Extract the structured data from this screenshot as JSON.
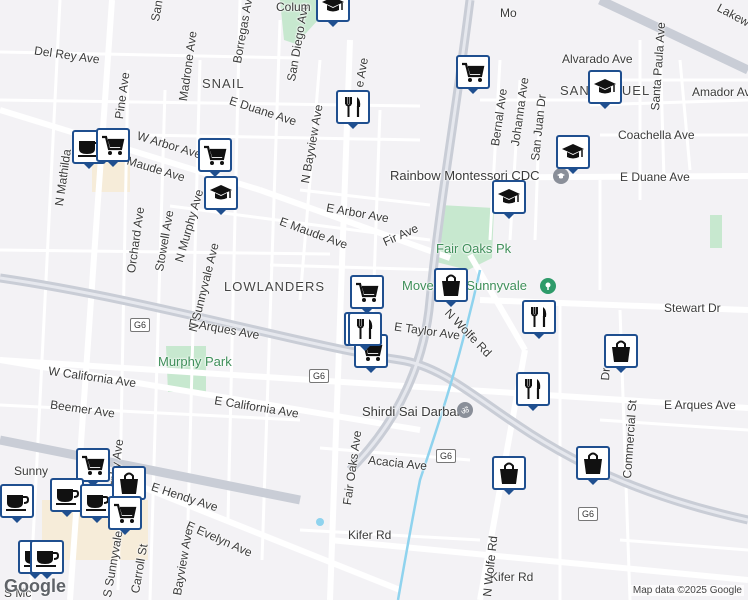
{
  "colors": {
    "road": "#ffffff",
    "highway": "#c9cdd6",
    "park": "#c7e8cf",
    "water": "#8fd3ee",
    "pin_border": "#1f4f8f",
    "poi_green": "#2e9b6a",
    "poi_gray": "#8a8f99"
  },
  "neighborhoods": [
    {
      "name": "SNAIL"
    },
    {
      "name": "LOWLANDERS"
    },
    {
      "name": "SAN MIGUEL"
    }
  ],
  "streets": [
    {
      "name": "Del Rey Ave"
    },
    {
      "name": "E Duane Ave"
    },
    {
      "name": "E Duane Ave"
    },
    {
      "name": "W Arbor Ave"
    },
    {
      "name": "Maude Ave"
    },
    {
      "name": "E Maude Ave"
    },
    {
      "name": "E Arbor Ave"
    },
    {
      "name": "Fir Ave"
    },
    {
      "name": "E Arques Ave"
    },
    {
      "name": "E Arques Ave"
    },
    {
      "name": "E Taylor Ave"
    },
    {
      "name": "W California Ave"
    },
    {
      "name": "E California Ave"
    },
    {
      "name": "Beemer Ave"
    },
    {
      "name": "Acacia Ave"
    },
    {
      "name": "E Hendy Ave"
    },
    {
      "name": "E Evelyn Ave"
    },
    {
      "name": "Kifer Rd"
    },
    {
      "name": "Kifer Rd"
    },
    {
      "name": "Stewart Dr"
    },
    {
      "name": "Alvarado Ave"
    },
    {
      "name": "Amador Ave"
    },
    {
      "name": "Coachella Ave"
    },
    {
      "name": "Lakew"
    },
    {
      "name": "N Mathilda"
    },
    {
      "name": "Pine Ave"
    },
    {
      "name": "Madrone Ave"
    },
    {
      "name": "Borregas Ave"
    },
    {
      "name": "San Diego Ave"
    },
    {
      "name": "N Bayview Ave"
    },
    {
      "name": "Orchard Ave"
    },
    {
      "name": "Stowell Ave"
    },
    {
      "name": "N Murphy Ave"
    },
    {
      "name": "N Sunnyvale Ave"
    },
    {
      "name": "Fair Oaks Ave"
    },
    {
      "name": "N Wolfe Rd"
    },
    {
      "name": "N Wolfe Rd"
    },
    {
      "name": "Bernal Ave"
    },
    {
      "name": "Johanna Ave"
    },
    {
      "name": "San Juan Dr"
    },
    {
      "name": "Santa Paula Ave"
    },
    {
      "name": "Commercial St"
    },
    {
      "name": "S Murphy Ave"
    },
    {
      "name": "S Sunnyvale Ave"
    },
    {
      "name": "Carroll St"
    },
    {
      "name": "Bayview Ave"
    },
    {
      "name": "Colum"
    },
    {
      "name": "Sunny"
    },
    {
      "name": "S Mc"
    },
    {
      "name": "San"
    },
    {
      "name": "Mo"
    },
    {
      "name": "e Ave"
    },
    {
      "name": "Dr"
    }
  ],
  "places": [
    {
      "name": "Fair Oaks Pk"
    },
    {
      "name": "Murphy Park"
    },
    {
      "name": "Rainbow Montessori CDC"
    },
    {
      "name": "Movement Sunnyvale"
    },
    {
      "name": "Shirdi Sai Darbar"
    }
  ],
  "route_shields": [
    {
      "text": "G6"
    },
    {
      "text": "G6"
    },
    {
      "text": "G6"
    },
    {
      "text": "G6"
    }
  ],
  "markers": [
    {
      "icon": "school"
    },
    {
      "icon": "shopping-cart"
    },
    {
      "icon": "restaurant"
    },
    {
      "icon": "school"
    },
    {
      "icon": "school"
    },
    {
      "icon": "school"
    },
    {
      "icon": "coffee"
    },
    {
      "icon": "shopping-cart"
    },
    {
      "icon": "shopping-cart"
    },
    {
      "icon": "school"
    },
    {
      "icon": "shopping-cart"
    },
    {
      "icon": "shopping-bag"
    },
    {
      "icon": "restaurant"
    },
    {
      "icon": "restaurant"
    },
    {
      "icon": "shopping-cart"
    },
    {
      "icon": "restaurant"
    },
    {
      "icon": "shopping-bag"
    },
    {
      "icon": "restaurant"
    },
    {
      "icon": "shopping-bag"
    },
    {
      "icon": "shopping-bag"
    },
    {
      "icon": "shopping-cart"
    },
    {
      "icon": "coffee"
    },
    {
      "icon": "coffee"
    },
    {
      "icon": "coffee"
    },
    {
      "icon": "shopping-bag"
    },
    {
      "icon": "coffee"
    },
    {
      "icon": "shopping-cart"
    },
    {
      "icon": "coffee"
    }
  ],
  "footer": {
    "logo": "Google",
    "attribution": "Map data ©2025 Google"
  }
}
